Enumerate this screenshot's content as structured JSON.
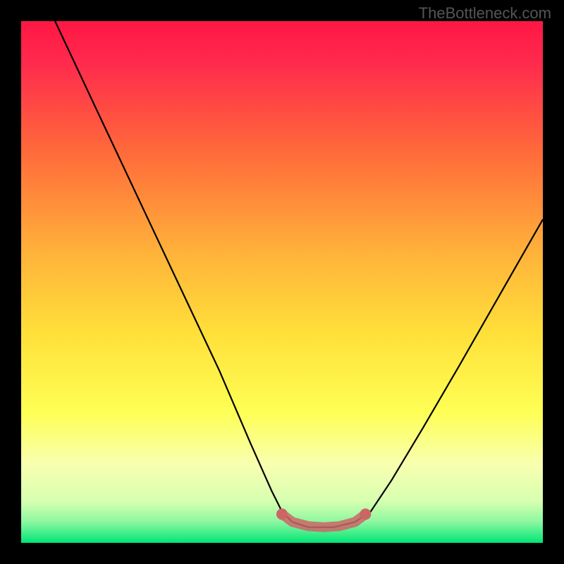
{
  "watermark": "TheBottleneck.com",
  "chart_data": {
    "type": "line",
    "title": "",
    "xlabel": "",
    "ylabel": "",
    "xlim": [
      0,
      100
    ],
    "ylim": [
      0,
      100
    ],
    "gradient_stops": [
      {
        "pct": 0,
        "color": "#ff1744"
      },
      {
        "pct": 8,
        "color": "#ff2a4d"
      },
      {
        "pct": 25,
        "color": "#ff6a3a"
      },
      {
        "pct": 45,
        "color": "#ffb43a"
      },
      {
        "pct": 60,
        "color": "#ffe03a"
      },
      {
        "pct": 75,
        "color": "#feff55"
      },
      {
        "pct": 85,
        "color": "#f8ffb0"
      },
      {
        "pct": 92,
        "color": "#d7ffb0"
      },
      {
        "pct": 96,
        "color": "#8cf7a0"
      },
      {
        "pct": 100,
        "color": "#00e676"
      }
    ],
    "series": [
      {
        "name": "curve",
        "color": "#000000",
        "points": [
          {
            "x": 6.5,
            "y": 100
          },
          {
            "x": 14,
            "y": 84
          },
          {
            "x": 22,
            "y": 67
          },
          {
            "x": 30,
            "y": 50
          },
          {
            "x": 38,
            "y": 33
          },
          {
            "x": 44,
            "y": 19
          },
          {
            "x": 48,
            "y": 10
          },
          {
            "x": 50,
            "y": 6
          },
          {
            "x": 52,
            "y": 4
          },
          {
            "x": 55,
            "y": 3
          },
          {
            "x": 60,
            "y": 3
          },
          {
            "x": 64,
            "y": 4
          },
          {
            "x": 67,
            "y": 6
          },
          {
            "x": 71,
            "y": 12
          },
          {
            "x": 77,
            "y": 22
          },
          {
            "x": 84,
            "y": 34
          },
          {
            "x": 92,
            "y": 48
          },
          {
            "x": 100,
            "y": 62
          }
        ]
      },
      {
        "name": "highlight-band",
        "color": "#cc6666",
        "points": [
          {
            "x": 50,
            "y": 5.5
          },
          {
            "x": 52,
            "y": 4
          },
          {
            "x": 55,
            "y": 3.2
          },
          {
            "x": 58,
            "y": 3
          },
          {
            "x": 61,
            "y": 3.2
          },
          {
            "x": 64,
            "y": 4
          },
          {
            "x": 66,
            "y": 5.5
          }
        ]
      }
    ]
  }
}
